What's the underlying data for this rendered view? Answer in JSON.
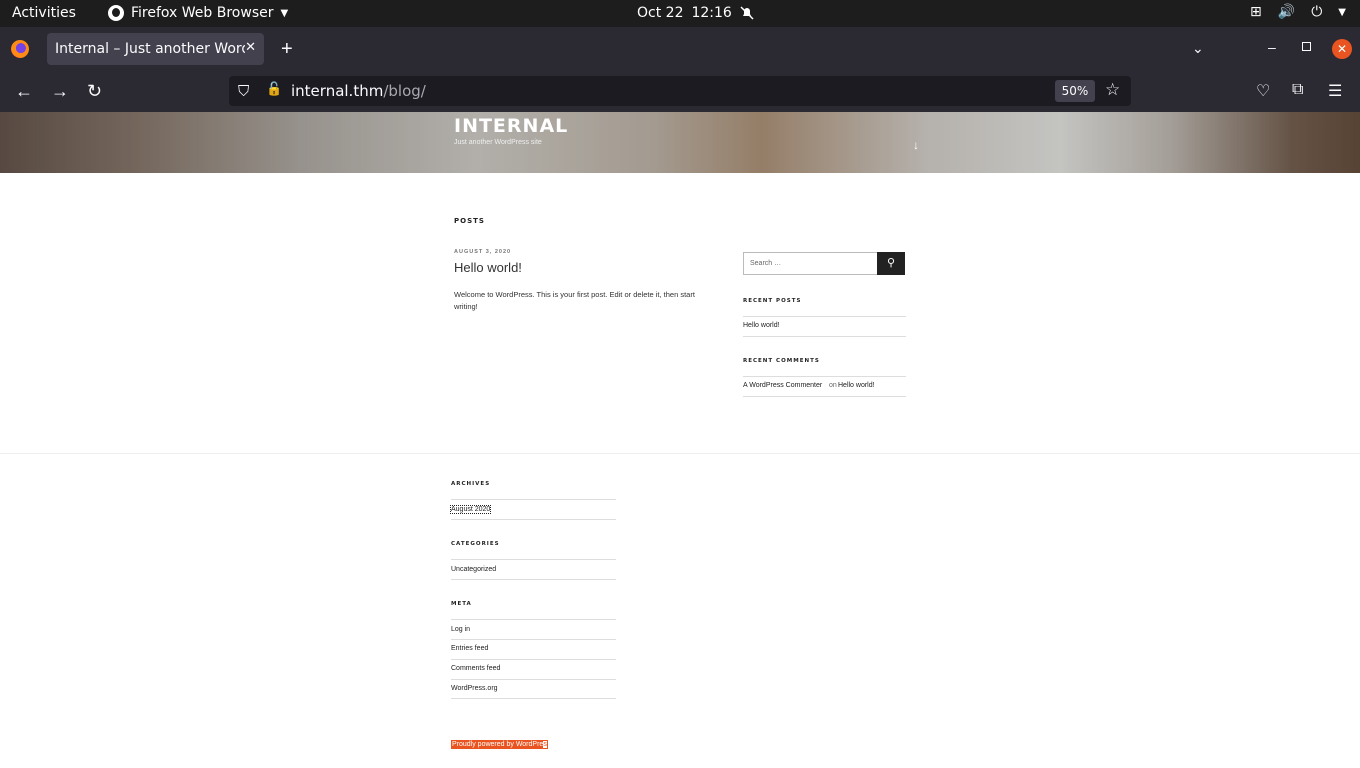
{
  "topbar": {
    "activities": "Activities",
    "app_name": "Firefox Web Browser",
    "date": "Oct 22",
    "time": "12:16"
  },
  "browser": {
    "tab_title": "Internal – Just another WordPress site",
    "url_host": "internal.thm",
    "url_path": "/blog/",
    "zoom": "50%"
  },
  "site": {
    "title": "INTERNAL",
    "description": "Just another WordPress site"
  },
  "main": {
    "posts_heading": "POSTS",
    "post": {
      "date": "AUGUST 3, 2020",
      "title": "Hello world!",
      "excerpt": "Welcome to WordPress. This is your first post. Edit or delete it, then start writing!"
    }
  },
  "sidebar": {
    "search_placeholder": "Search …",
    "recent_posts_title": "RECENT POSTS",
    "recent_posts": [
      "Hello world!"
    ],
    "recent_comments_title": "RECENT COMMENTS",
    "comment_author": "A WordPress Commenter",
    "comment_on": "on",
    "comment_post": "Hello world!"
  },
  "footer": {
    "archives_title": "ARCHIVES",
    "archives": [
      "August 2020"
    ],
    "categories_title": "CATEGORIES",
    "categories": [
      "Uncategorized"
    ],
    "meta_title": "META",
    "meta": [
      "Log in",
      "Entries feed",
      "Comments feed",
      "WordPress.org"
    ],
    "powered_main": "Proudly powered by WordPre",
    "powered_tail": "s"
  },
  "colors": {
    "accent": "#e95420",
    "firefox_bar": "#2b2a33"
  }
}
